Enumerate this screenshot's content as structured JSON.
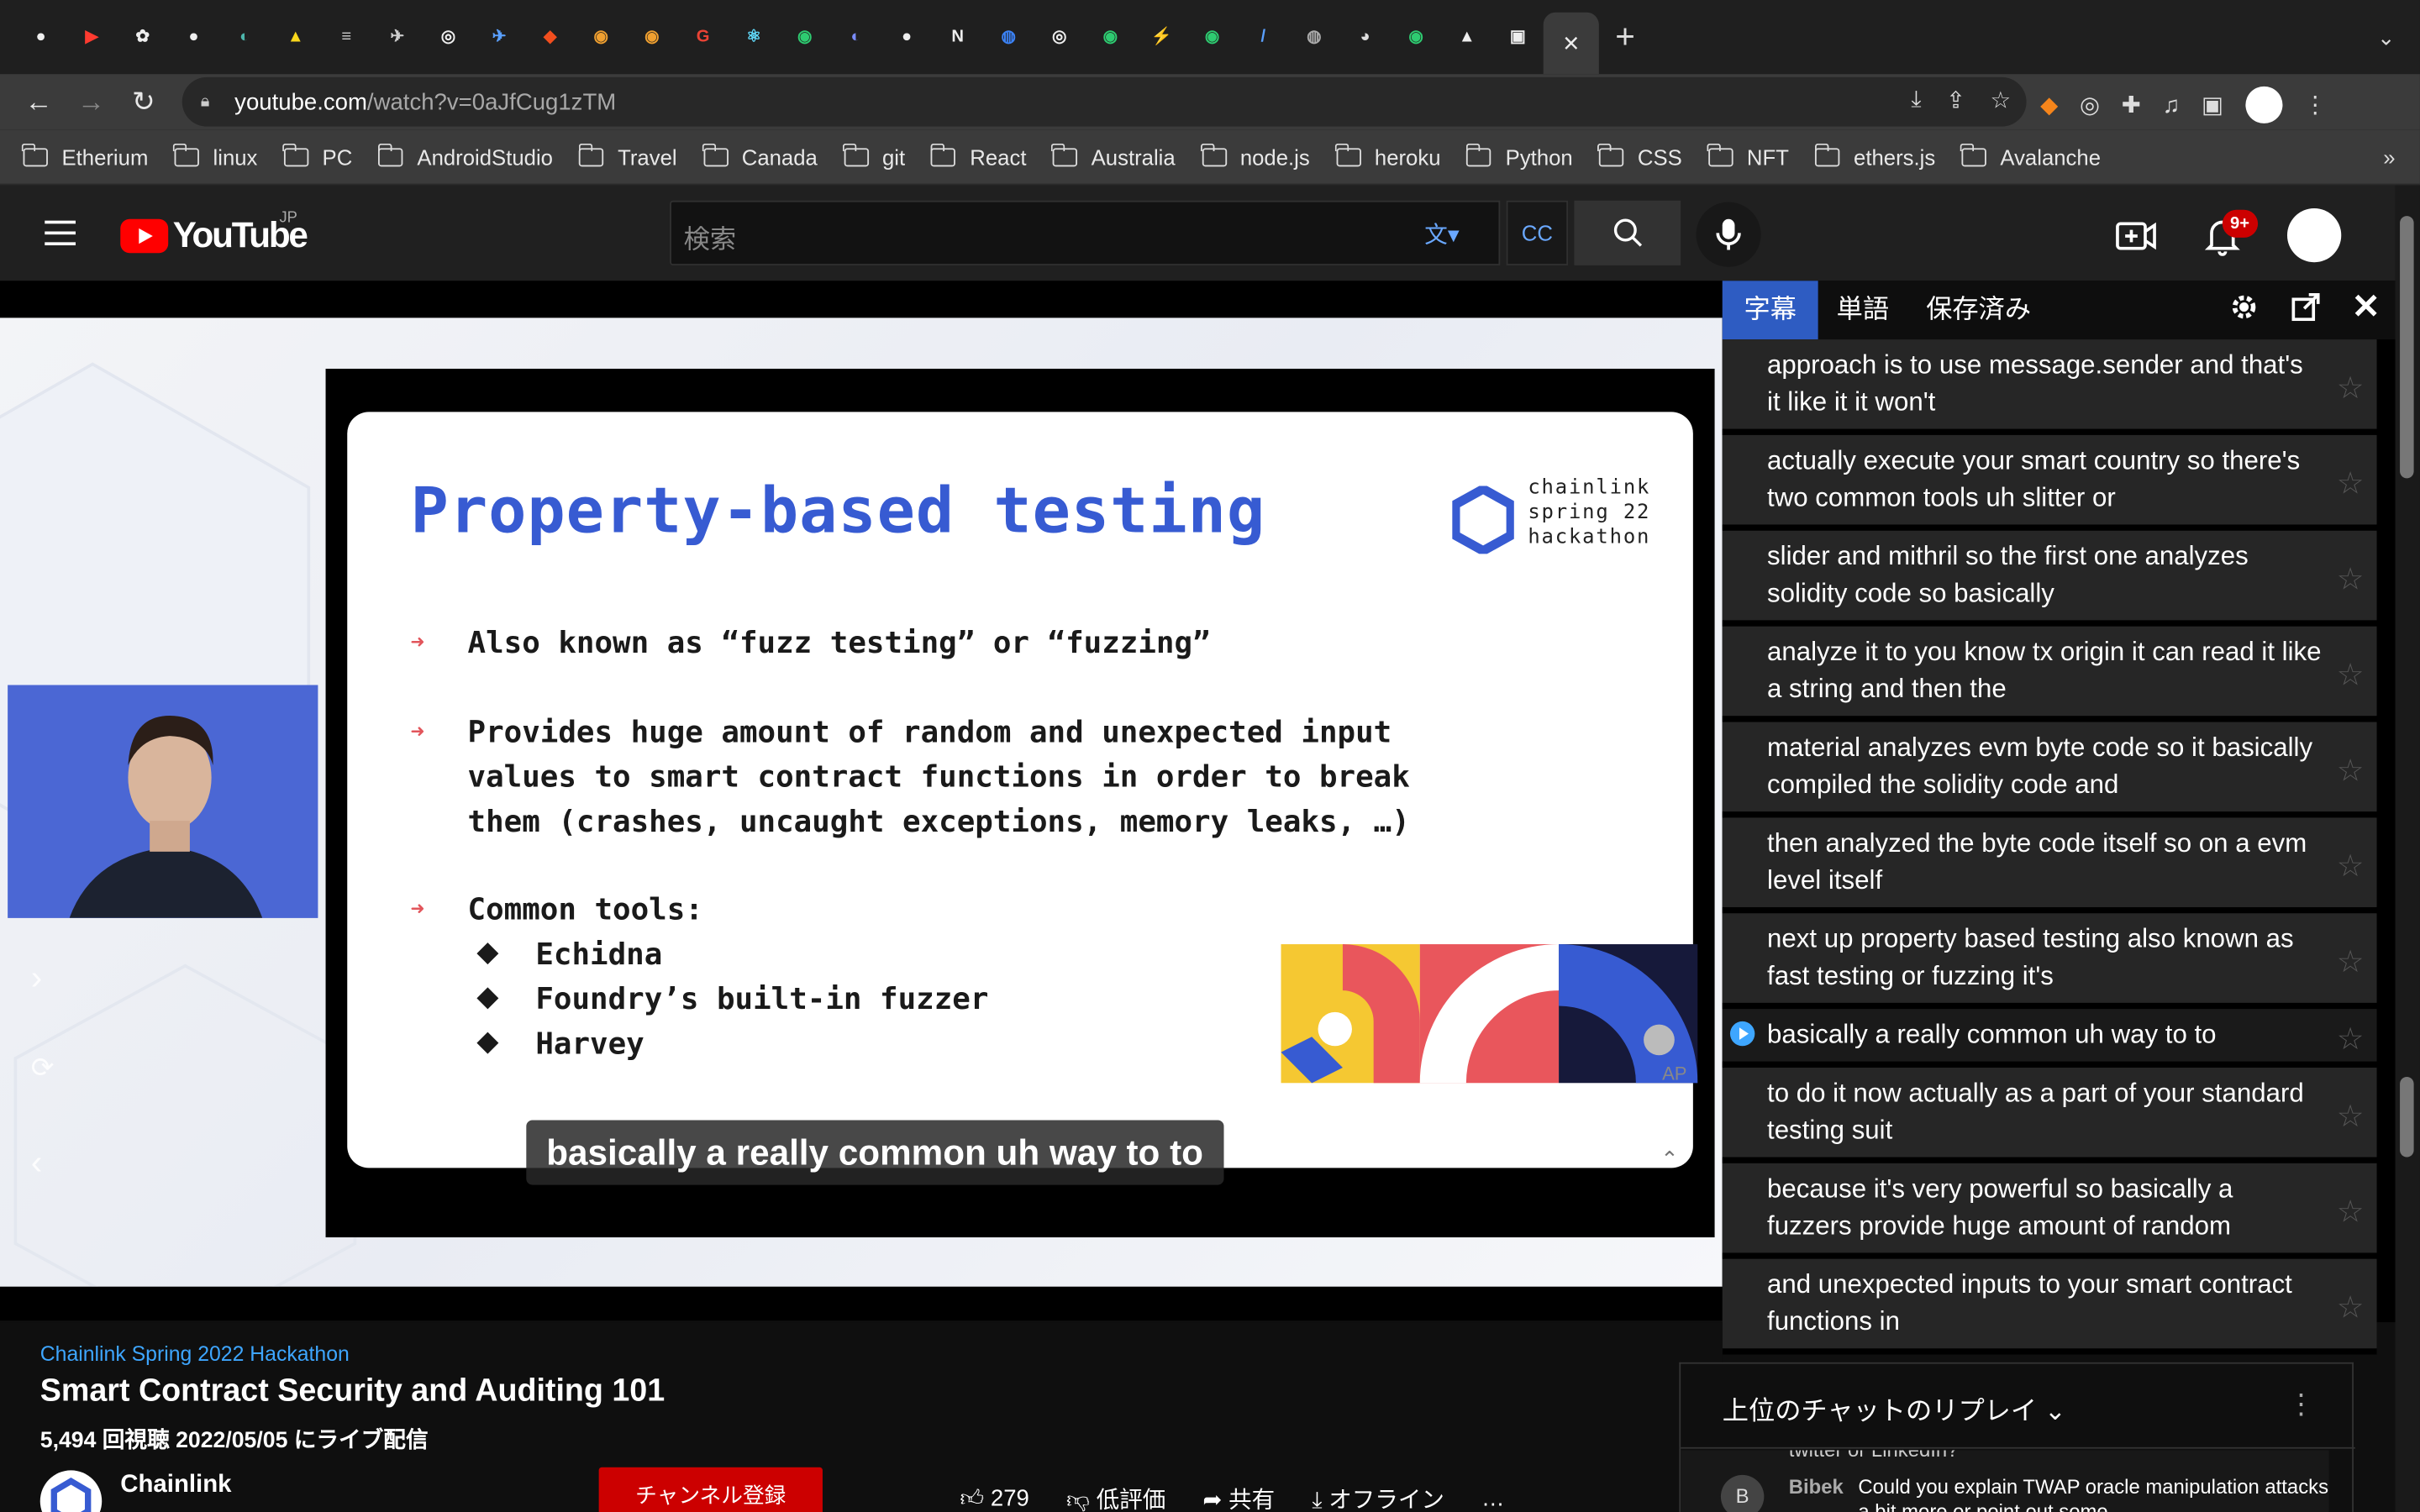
{
  "browser": {
    "tabs_icon_names": [
      "github-icon",
      "youtube-icon",
      "openai-icon",
      "github-icon",
      "tab-icon",
      "drive-icon",
      "tab-icon",
      "tab-icon",
      "chrome-icon",
      "tab-icon",
      "figma-icon",
      "tab-icon",
      "tab-icon",
      "google-icon",
      "react-icon",
      "tab-icon",
      "tab-icon",
      "github-icon",
      "notion-icon",
      "safari-icon",
      "chrome-icon",
      "tab-icon",
      "tab-icon",
      "tab-icon",
      "tab-icon",
      "tab-icon",
      "tab-icon",
      "tab-icon",
      "tab-icon",
      "tab-icon"
    ],
    "active_tab_close": "×",
    "new_tab": "+",
    "tab_menu": "⌄",
    "url_host": "youtube.com",
    "url_path": "/watch?v=0aJfCug1zTM",
    "bookmarks": [
      "Etherium",
      "linux",
      "PC",
      "AndroidStudio",
      "Travel",
      "Canada",
      "git",
      "React",
      "Australia",
      "node.js",
      "heroku",
      "Python",
      "CSS",
      "NFT",
      "ethers.js",
      "Avalanche"
    ],
    "bookmarks_more": "»"
  },
  "youtube": {
    "logo_text": "YouTube",
    "region": "JP",
    "search_placeholder": "検索",
    "notifications_badge": "9+"
  },
  "slide": {
    "title": "Property-based testing",
    "logo_lines": [
      "chainlink",
      "spring 22",
      "hackathon"
    ],
    "bullet1": "Also known as “fuzz testing” or “fuzzing”",
    "bullet2_l1": "Provides huge amount of random and unexpected input",
    "bullet2_l2": "values to smart contract functions in order to break",
    "bullet2_l3": "them (crashes, uncaught exceptions, memory leaks, …)",
    "bullet3": "Common tools:",
    "tools": [
      "Echidna",
      "Foundry’s built-in fuzzer",
      "Harvey"
    ],
    "art_label": "AP"
  },
  "caption_overlay": "basically a really common uh way to to",
  "subtitle_panel": {
    "tabs": [
      "字幕",
      "単語",
      "保存済み"
    ],
    "cues": [
      "approach is to use message.sender and that's it like it it won't",
      "actually execute your smart country so there's two common tools uh slitter or",
      "slider and mithril so the first one analyzes solidity code so basically",
      "analyze it to you know tx origin it can read it like a string and then the",
      "material analyzes evm byte code so it basically compiled the solidity code and",
      "then analyzed the byte code itself so on a evm level itself",
      "next up property based testing also known as fast testing or fuzzing it's",
      "basically a really common uh way to to",
      "to do it now actually as a part of your standard testing suit",
      "because it's very powerful so basically a fuzzers provide huge amount of random",
      "and unexpected inputs to your smart contract functions in"
    ],
    "star": "☆"
  },
  "video": {
    "hashtag": "Chainlink Spring 2022 Hackathon",
    "title": "Smart Contract Security and Auditing 101",
    "meta": "5,494 回視聴  2022/05/05 にライブ配信",
    "channel": "Chainlink",
    "subscribe": "チャンネル登録",
    "likes": "279",
    "dislike": "低評価",
    "share": "共有",
    "offline": "オフライン",
    "more": "…"
  },
  "chat": {
    "title": "上位のチャットのリプレイ",
    "prev_line": "twitter or LinkedIn?",
    "avatar_letter": "B",
    "author": "Bibek",
    "message": "Could you explain TWAP oracle manipulation attacks a bit more or point out some"
  },
  "colors": {
    "brand_red": "#ff0000",
    "slide_title": "#375bd2",
    "active_tab_blue": "#2e5cc2",
    "link_blue": "#3ea6ff"
  }
}
